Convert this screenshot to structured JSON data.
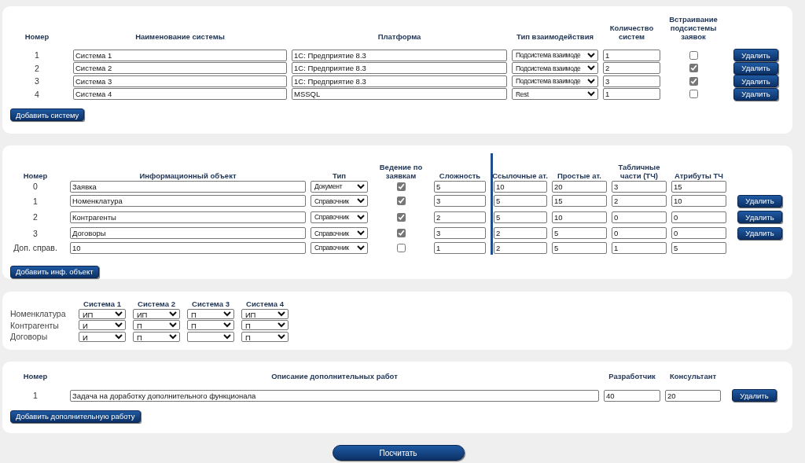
{
  "systems": {
    "columns": [
      "Номер",
      "Наименование системы",
      "Платформа",
      "Тип взаимодействия",
      "Количество систем",
      "Встраивание подсистемы заявок"
    ],
    "rows": [
      {
        "number": "1",
        "name": "Система 1",
        "platform": "1С: Предприятие 8.3",
        "interaction": "Подсистема взаимоде",
        "count": "1",
        "checked": false,
        "delete_button": "Удалить"
      },
      {
        "number": "2",
        "name": "Система 2",
        "platform": "1С: Предприятие 8.3",
        "interaction": "Подсистема взаимоде",
        "count": "2",
        "checked": true,
        "delete_button": "Удалить"
      },
      {
        "number": "3",
        "name": "Система 3",
        "platform": "1С: Предприятие 8.3",
        "interaction": "Подсистема взаимоде",
        "count": "3",
        "checked": true,
        "delete_button": "Удалить"
      },
      {
        "number": "4",
        "name": "Система 4",
        "platform": "MSSQL",
        "interaction": "Rest",
        "count": "1",
        "checked": false,
        "delete_button": "Удалить"
      }
    ],
    "add_button": "Добавить систему"
  },
  "objects": {
    "columns": [
      "Номер",
      "Информационный объект",
      "Тип",
      "Ведение по заявкам",
      "Сложность",
      "Ссылочные ат.",
      "Простые ат.",
      "Табличные части (ТЧ)",
      "Атрибуты ТЧ"
    ],
    "rows": [
      {
        "number": "0",
        "name": "Заявка",
        "type": "Документ",
        "checked": true,
        "complexity": "5",
        "ref_attrs": "10",
        "simple_attrs": "20",
        "tab_parts": "3",
        "tab_attrs": "15"
      },
      {
        "number": "1",
        "name": "Номенклатура",
        "type": "Справочник",
        "checked": true,
        "complexity": "3",
        "ref_attrs": "5",
        "simple_attrs": "15",
        "tab_parts": "2",
        "tab_attrs": "10",
        "delete_button": "Удалить"
      },
      {
        "number": "2",
        "name": "Контрагенты",
        "type": "Справочник",
        "checked": true,
        "complexity": "2",
        "ref_attrs": "5",
        "simple_attrs": "10",
        "tab_parts": "0",
        "tab_attrs": "0",
        "delete_button": "Удалить"
      },
      {
        "number": "3",
        "name": "Договоры",
        "type": "Справочник",
        "checked": true,
        "complexity": "3",
        "ref_attrs": "2",
        "simple_attrs": "5",
        "tab_parts": "0",
        "tab_attrs": "0",
        "delete_button": "Удалить"
      },
      {
        "number": "Доп. справ.",
        "name": "10",
        "type": "Справочник",
        "checked": false,
        "complexity": "1",
        "ref_attrs": "2",
        "simple_attrs": "5",
        "tab_parts": "1",
        "tab_attrs": "5"
      }
    ],
    "add_button": "Добавить инф. объект"
  },
  "matrix": {
    "columns": [
      "Система 1",
      "Система 2",
      "Система 3",
      "Система 4"
    ],
    "rows": [
      {
        "label": "Номенклатура",
        "cells": [
          "ИП",
          "ИП",
          "П",
          "ИП"
        ]
      },
      {
        "label": "Контрагенты",
        "cells": [
          "И",
          "П",
          "П",
          "П"
        ]
      },
      {
        "label": "Договоры",
        "cells": [
          "И",
          "П",
          null,
          "П"
        ]
      }
    ]
  },
  "works": {
    "columns": [
      "Номер",
      "Описание дополнительных работ",
      "Разработчик",
      "Консультант"
    ],
    "rows": [
      {
        "number": "1",
        "description": "Задача на доработку дополнительного функционала",
        "developer": "40",
        "consultant": "20",
        "delete_button": "Удалить"
      }
    ],
    "add_button": "Добавить дополнительную работу"
  },
  "calculate_button": "Посчитать"
}
